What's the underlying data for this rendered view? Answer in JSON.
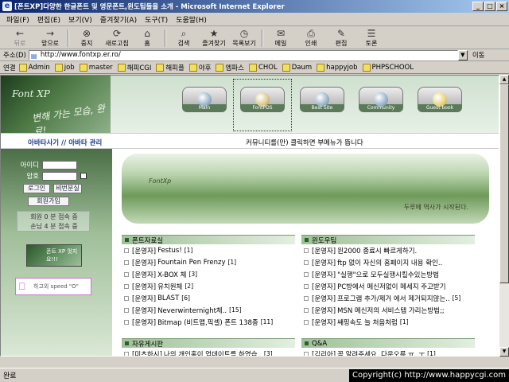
{
  "window": {
    "title": "[폰트XP]다양한 한글폰트 및 영문폰트,윈도팁들을 소개 - Microsoft Internet Explorer",
    "controls": [
      "_",
      "□",
      "×"
    ]
  },
  "menu": [
    "파일(F)",
    "편집(E)",
    "보기(V)",
    "즐겨찾기(A)",
    "도구(T)",
    "도움말(H)"
  ],
  "toolbar": [
    {
      "label": "뒤로",
      "icon": "back-arrow",
      "glyph": "←",
      "disabled": true
    },
    {
      "label": "앞으로",
      "icon": "forward-arrow",
      "glyph": "→",
      "disabled": false
    },
    {
      "label": "중지",
      "icon": "stop",
      "glyph": "⊗",
      "disabled": false
    },
    {
      "label": "새로고침",
      "icon": "refresh",
      "glyph": "⟳",
      "disabled": false
    },
    {
      "label": "홈",
      "icon": "home",
      "glyph": "⌂",
      "disabled": false
    },
    {
      "label": "검색",
      "icon": "search",
      "glyph": "⌕",
      "disabled": false
    },
    {
      "label": "즐겨찾기",
      "icon": "favorites",
      "glyph": "★",
      "disabled": false
    },
    {
      "label": "목록보기",
      "icon": "history",
      "glyph": "◷",
      "disabled": false
    },
    {
      "label": "메일",
      "icon": "mail",
      "glyph": "✉",
      "disabled": false
    },
    {
      "label": "인쇄",
      "icon": "print",
      "glyph": "⎙",
      "disabled": false
    },
    {
      "label": "편집",
      "icon": "edit",
      "glyph": "✎",
      "disabled": false
    },
    {
      "label": "토론",
      "icon": "discuss",
      "glyph": "☰",
      "disabled": false
    }
  ],
  "address": {
    "label": "주소(D)",
    "url": "http://www.fontxp.er.ro/",
    "go": "이동"
  },
  "links": {
    "label": "연결",
    "items": [
      "Admin",
      "job",
      "master",
      "해피CGI",
      "해피플",
      "야후",
      "엠파스",
      "CHOL",
      "Daum",
      "happyjob",
      "PHPSCHOOL"
    ]
  },
  "site": {
    "logo": "Font XP",
    "slogan": "변해 가는 모습, 완료!",
    "nav": [
      {
        "key": "main",
        "label": "Main"
      },
      {
        "key": "fontpds",
        "label": "FontPDS"
      },
      {
        "key": "bestsite",
        "label": "Best Site"
      },
      {
        "key": "community",
        "label": "Community"
      },
      {
        "key": "guestbook",
        "label": "Guest book"
      }
    ],
    "avatar_links": "아바타사기 // 아바타 관리",
    "notice": "커뮤니티를(만) 클릭하면 부메뉴가 뜹니다",
    "login": {
      "id_label": "아이디",
      "pw_label": "암호",
      "login_btn": "로그인",
      "pw_find_btn": "비번분실",
      "join_btn": "회원가입"
    },
    "stats": {
      "members": "회원 0 분 접속 중",
      "guests": "손님 4 분 접속 중"
    },
    "fontxp_banner": "폰트 XP 멋지요!!!",
    "speed_banner": "하고외 speed \"O\"",
    "hero": {
      "fx": "FontXp",
      "caption": "두루에 역사가 시작된다."
    },
    "boards": [
      {
        "title": "폰트자료실",
        "more": "more",
        "rows": [
          {
            "tag": "[운영자]",
            "text": "Festus!",
            "count": "[1]"
          },
          {
            "tag": "[운영자]",
            "text": "Fountain Pen Frenzy",
            "count": "[1]"
          },
          {
            "tag": "[운영자]",
            "text": "X-BOX 체",
            "count": "[3]"
          },
          {
            "tag": "[운영자]",
            "text": "유치원체",
            "count": "[2]"
          },
          {
            "tag": "[운영자]",
            "text": "BLAST",
            "count": "[6]"
          },
          {
            "tag": "[운영자]",
            "text": "Neverwinternight체..",
            "count": "[15]"
          },
          {
            "tag": "[운영자]",
            "text": "Bitmap (비트맵,픽셀) 폰트 138종",
            "count": "[11]"
          }
        ]
      },
      {
        "title": "윈도우팁",
        "more": "more",
        "rows": [
          {
            "tag": "[운영자]",
            "text": "윈2000 종료시 빠르게하기.",
            "count": ""
          },
          {
            "tag": "[운영자]",
            "text": "ftp 없이 자신의 홈페이지 내용 확인..",
            "count": ""
          },
          {
            "tag": "[운영자]",
            "text": "\"실행\"으로 모두실행시킬수있는방법",
            "count": ""
          },
          {
            "tag": "[운영자]",
            "text": "PC방에서 메신저없이 메세지 주고받기",
            "count": ""
          },
          {
            "tag": "[운영자]",
            "text": "프로그램 추가/제거 에서 제거되지않는..",
            "count": "[5]"
          },
          {
            "tag": "[운영자]",
            "text": "MSN 메신저의 서비스탭 가리는방법;;",
            "count": ""
          },
          {
            "tag": "[운영자]",
            "text": "쌔핑속도 늘 처음처럼",
            "count": "[1]"
          }
        ]
      },
      {
        "title": "자유게시판",
        "more": "more",
        "rows": [
          {
            "tag": "[미츠하시]",
            "text": "나의 개인홈이 업데이트를 하였습..",
            "count": "[3]"
          }
        ]
      },
      {
        "title": "Q&A",
        "more": "more",
        "rows": [
          {
            "tag": "[김리아]",
            "text": "꼭 알려주세요. 다운오류 ㅠ..ㅜ",
            "count": "[1]"
          }
        ]
      }
    ]
  },
  "status": {
    "text": "완료",
    "copyright": "Copyright(c) http://www.happycgi.com"
  },
  "colors": {
    "titlebar": "#0a246a",
    "accent_green": "#2f5f2f",
    "nav_text": "#1c3a8c"
  }
}
